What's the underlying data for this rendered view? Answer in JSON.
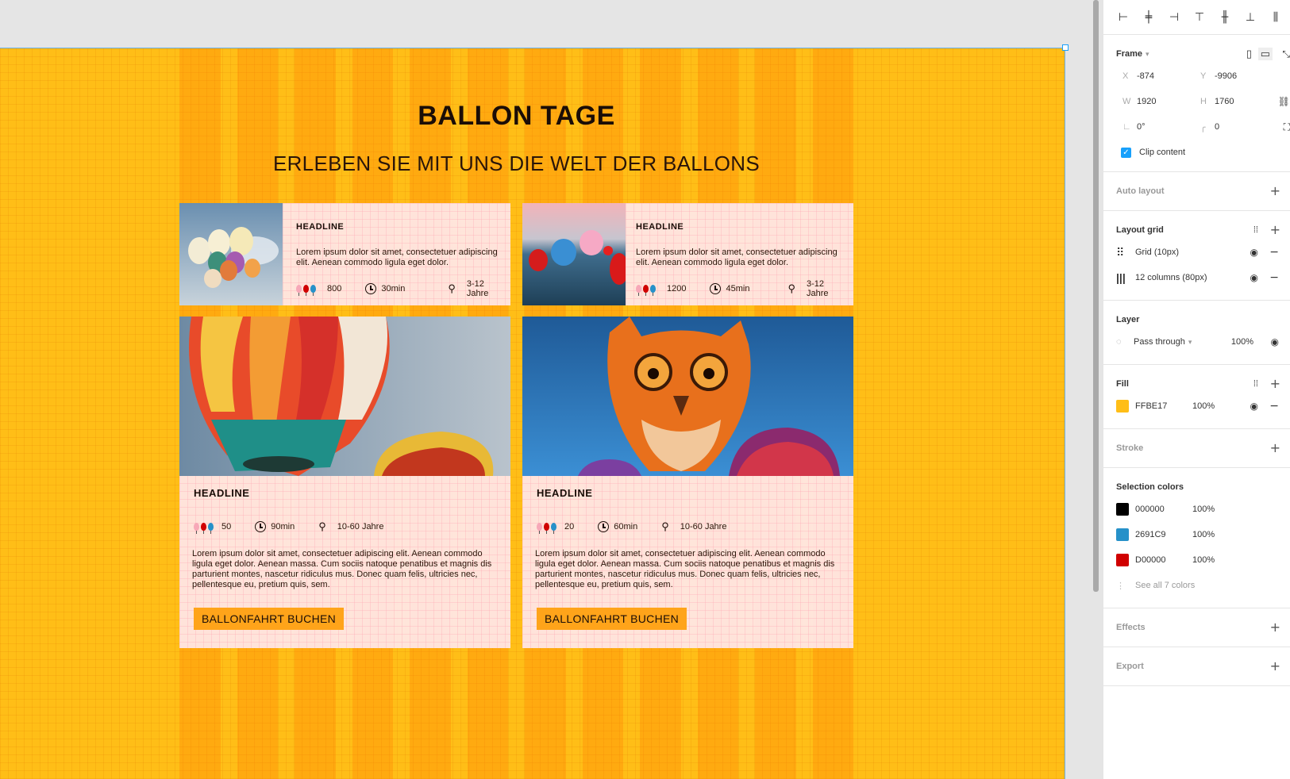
{
  "canvas": {
    "frame_fill": "#FFBE17",
    "headline": "BALLON TAGE",
    "subheadline": "ERLEBEN SIE MIT UNS DIE WELT DER BALLONS",
    "small_cards": [
      {
        "headline": "HEADLINE",
        "text": "Lorem ipsum dolor sit amet, consectetuer adipiscing elit. Aenean commodo ligula eget dolor.",
        "count": "800",
        "duration": "30min",
        "age": "3-12 Jahre"
      },
      {
        "headline": "HEADLINE",
        "text": "Lorem ipsum dolor sit amet, consectetuer adipiscing elit. Aenean commodo ligula eget dolor.",
        "count": "1200",
        "duration": "45min",
        "age": "3-12 Jahre"
      }
    ],
    "big_cards": [
      {
        "headline": "HEADLINE",
        "count": "50",
        "duration": "90min",
        "age": "10-60 Jahre",
        "text": "Lorem ipsum dolor sit amet, consectetuer adipiscing elit. Aenean commodo ligula eget dolor. Aenean massa. Cum sociis natoque penatibus et magnis dis parturient montes, nascetur ridiculus mus. Donec quam felis, ultricies nec, pellentesque eu, pretium quis, sem.",
        "button": "BALLONFAHRT BUCHEN"
      },
      {
        "headline": "HEADLINE",
        "count": "20",
        "duration": "60min",
        "age": "10-60 Jahre",
        "text": "Lorem ipsum dolor sit amet, consectetuer adipiscing elit. Aenean commodo ligula eget dolor. Aenean massa. Cum sociis natoque penatibus et magnis dis parturient montes, nascetur ridiculus mus. Donec quam felis, ultricies nec, pellentesque eu, pretium quis, sem.",
        "button": "BALLONFAHRT BUCHEN"
      }
    ]
  },
  "panel": {
    "frame_label": "Frame",
    "x_label": "X",
    "x": "-874",
    "y_label": "Y",
    "y": "-9906",
    "w_label": "W",
    "w": "1920",
    "h_label": "H",
    "h": "1760",
    "rotation": "0°",
    "radius": "0",
    "clip_content": "Clip content",
    "auto_layout": "Auto layout",
    "layout_grid": "Layout grid",
    "grids": [
      "Grid (10px)",
      "12 columns (80px)"
    ],
    "layer": "Layer",
    "blend": "Pass through",
    "layer_opacity": "100%",
    "fill": "Fill",
    "fill_hex": "FFBE17",
    "fill_opacity": "100%",
    "stroke": "Stroke",
    "selection_colors": "Selection colors",
    "colors": [
      {
        "hex": "000000",
        "opacity": "100%",
        "swatch": "#000000"
      },
      {
        "hex": "2691C9",
        "opacity": "100%",
        "swatch": "#2691C9"
      },
      {
        "hex": "D00000",
        "opacity": "100%",
        "swatch": "#D00000"
      }
    ],
    "see_all": "See all 7 colors",
    "effects": "Effects",
    "export": "Export"
  }
}
